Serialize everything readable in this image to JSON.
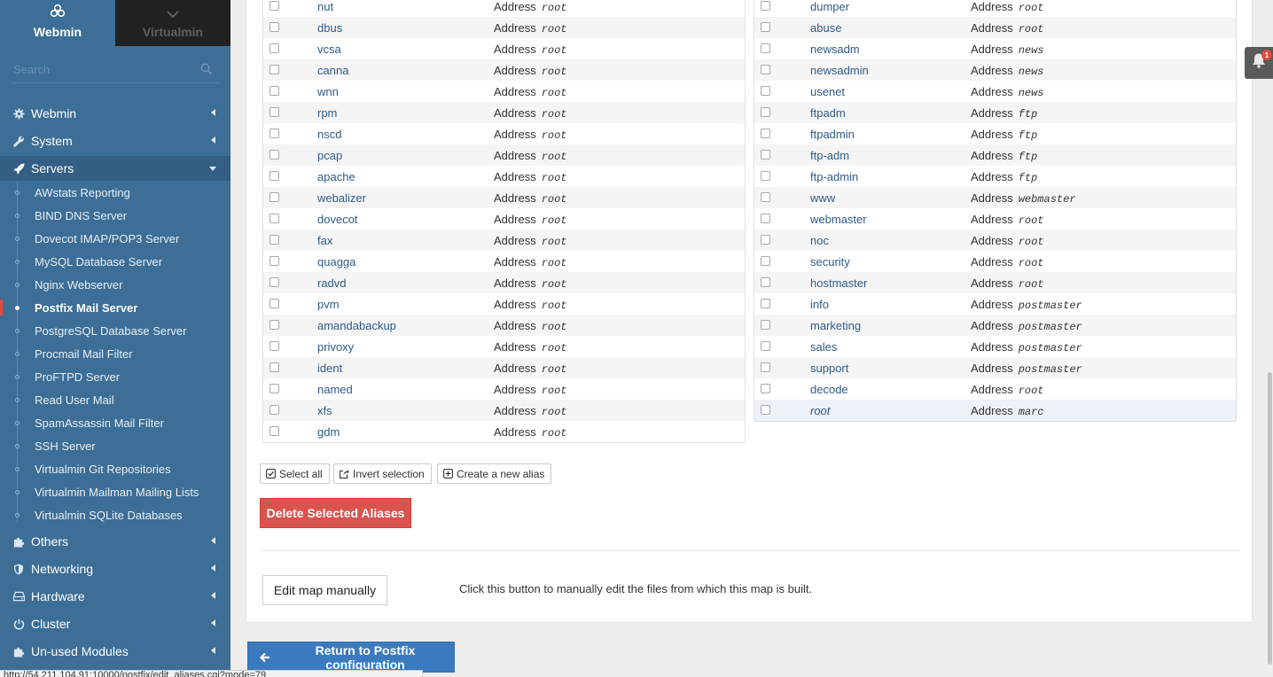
{
  "sidebar": {
    "tabs": [
      {
        "label": "Webmin",
        "icon": "webmin-logo-icon"
      },
      {
        "label": "Virtualmin",
        "icon": "chevron-down-icon"
      }
    ],
    "search_placeholder": "Search",
    "categories": [
      {
        "label": "Webmin",
        "icon": "gear-icon"
      },
      {
        "label": "System",
        "icon": "wrench-icon"
      },
      {
        "label": "Servers",
        "icon": "rocket-icon"
      },
      {
        "label": "Others",
        "icon": "puzzle-icon"
      },
      {
        "label": "Networking",
        "icon": "shield-icon"
      },
      {
        "label": "Hardware",
        "icon": "hdd-icon"
      },
      {
        "label": "Cluster",
        "icon": "power-icon"
      },
      {
        "label": "Un-used Modules",
        "icon": "puzzle-icon"
      }
    ],
    "server_items": [
      "AWstats Reporting",
      "BIND DNS Server",
      "Dovecot IMAP/POP3 Server",
      "MySQL Database Server",
      "Nginx Webserver",
      "Postfix Mail Server",
      "PostgreSQL Database Server",
      "Procmail Mail Filter",
      "ProFTPD Server",
      "Read User Mail",
      "SpamAssassin Mail Filter",
      "SSH Server",
      "Virtualmin Git Repositories",
      "Virtualmin Mailman Mailing Lists",
      "Virtualmin SQLite Databases"
    ],
    "current_item": "Postfix Mail Server"
  },
  "aliases": {
    "address_label": "Address",
    "left": [
      {
        "name": "nut",
        "value": "root"
      },
      {
        "name": "dbus",
        "value": "root"
      },
      {
        "name": "vcsa",
        "value": "root"
      },
      {
        "name": "canna",
        "value": "root"
      },
      {
        "name": "wnn",
        "value": "root"
      },
      {
        "name": "rpm",
        "value": "root"
      },
      {
        "name": "nscd",
        "value": "root"
      },
      {
        "name": "pcap",
        "value": "root"
      },
      {
        "name": "apache",
        "value": "root"
      },
      {
        "name": "webalizer",
        "value": "root"
      },
      {
        "name": "dovecot",
        "value": "root"
      },
      {
        "name": "fax",
        "value": "root"
      },
      {
        "name": "quagga",
        "value": "root"
      },
      {
        "name": "radvd",
        "value": "root"
      },
      {
        "name": "pvm",
        "value": "root"
      },
      {
        "name": "amandabackup",
        "value": "root"
      },
      {
        "name": "privoxy",
        "value": "root"
      },
      {
        "name": "ident",
        "value": "root"
      },
      {
        "name": "named",
        "value": "root"
      },
      {
        "name": "xfs",
        "value": "root"
      },
      {
        "name": "gdm",
        "value": "root"
      }
    ],
    "right": [
      {
        "name": "dumper",
        "value": "root"
      },
      {
        "name": "abuse",
        "value": "root"
      },
      {
        "name": "newsadm",
        "value": "news"
      },
      {
        "name": "newsadmin",
        "value": "news"
      },
      {
        "name": "usenet",
        "value": "news"
      },
      {
        "name": "ftpadm",
        "value": "ftp"
      },
      {
        "name": "ftpadmin",
        "value": "ftp"
      },
      {
        "name": "ftp-adm",
        "value": "ftp"
      },
      {
        "name": "ftp-admin",
        "value": "ftp"
      },
      {
        "name": "www",
        "value": "webmaster"
      },
      {
        "name": "webmaster",
        "value": "root"
      },
      {
        "name": "noc",
        "value": "root"
      },
      {
        "name": "security",
        "value": "root"
      },
      {
        "name": "hostmaster",
        "value": "root"
      },
      {
        "name": "info",
        "value": "postmaster"
      },
      {
        "name": "marketing",
        "value": "postmaster"
      },
      {
        "name": "sales",
        "value": "postmaster"
      },
      {
        "name": "support",
        "value": "postmaster"
      },
      {
        "name": "decode",
        "value": "root"
      },
      {
        "name": "root",
        "value": "marc"
      }
    ]
  },
  "actions": {
    "select_all": "Select all",
    "invert_selection": "Invert selection",
    "create_alias": "Create a new alias",
    "delete_selected": "Delete Selected Aliases",
    "edit_map": "Edit map manually",
    "edit_map_desc": "Click this button to manually edit the files from which this map is built.",
    "return": "Return to Postfix configuration"
  },
  "notifications": {
    "count": "1"
  },
  "statusbar": {
    "url": "http://54.211.104.91:10000/postfix/edit_aliases.cgi?mode=79"
  },
  "colors": {
    "sidebar": "#3c6e96",
    "link": "#2f5b86",
    "danger": "#d9534f",
    "primary": "#3a7bbf",
    "active_marker": "#e04b3c"
  }
}
